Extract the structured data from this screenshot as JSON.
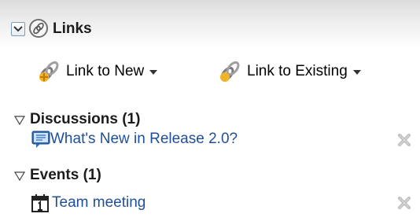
{
  "panel": {
    "title": "Links"
  },
  "toolbar": {
    "link_to_new_label": "Link to New",
    "link_to_existing_label": "Link to Existing"
  },
  "groups": [
    {
      "header": "Discussions (1)",
      "items": [
        {
          "label": "What's New in Release 2.0?",
          "icon": "discussion-icon"
        }
      ]
    },
    {
      "header": "Events (1)",
      "items": [
        {
          "label": "Team meeting",
          "icon": "calendar-icon"
        }
      ]
    }
  ],
  "colors": {
    "link": "#1f4f9a",
    "header_gradient_top": "#dcdcdc",
    "remove_icon": "#b8b8b8"
  }
}
